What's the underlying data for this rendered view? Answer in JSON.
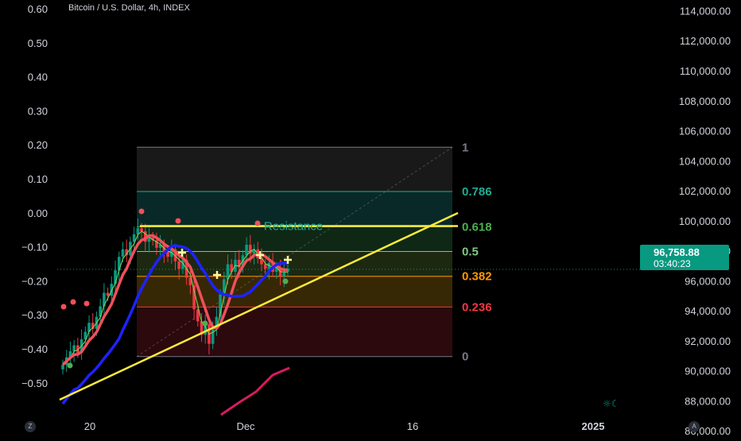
{
  "header": {
    "title": "Bitcoin / U.S. Dollar, 4h, INDEX"
  },
  "price_tag": {
    "price": "96,758.88",
    "countdown": "03:40:23"
  },
  "corner": {
    "left": "Z",
    "right": "A"
  },
  "colors": {
    "background": "#000000",
    "up": "#089981",
    "down": "#f23645",
    "ma_red": "#f0505a",
    "ma_blue": "#1e22ff",
    "ma_green": "#7ed957",
    "trendline": "#ffeb3b"
  },
  "chart_data": {
    "type": "candlestick",
    "left_axis": {
      "ticks": [
        0.6,
        0.5,
        0.4,
        0.3,
        0.2,
        0.1,
        0.0,
        -0.1,
        -0.2,
        -0.3,
        -0.4,
        -0.5
      ],
      "tick_labels": [
        "0.60",
        "0.50",
        "0.40",
        "0.30",
        "0.20",
        "0.10",
        "0.00",
        "−0.10",
        "−0.20",
        "−0.30",
        "−0.40",
        "−0.50"
      ]
    },
    "right_axis": {
      "ticks": [
        114000,
        112000,
        110000,
        108000,
        106000,
        104000,
        102000,
        100000,
        98000,
        96000,
        94000,
        92000,
        90000,
        88000,
        86000
      ],
      "tick_labels": [
        "114,000.00",
        "112,000.00",
        "110,000.00",
        "108,000.00",
        "106,000.00",
        "104,000.00",
        "102,000.00",
        "100,000.00",
        "98,000.00",
        "96,000.00",
        "94,000.00",
        "92,000.00",
        "90,000.00",
        "88,000.00",
        "86,000.00"
      ],
      "range": [
        85800,
        114500
      ]
    },
    "x_axis": {
      "tick_labels": [
        "20",
        "Dec",
        "16",
        "2025"
      ]
    },
    "last_price": 96758.88,
    "fib_levels": [
      {
        "level": 1,
        "label": "1",
        "price": 104900,
        "color": "#787b86"
      },
      {
        "level": 0.786,
        "label": "0.786",
        "price": 101950,
        "color": "#22ab94"
      },
      {
        "level": 0.618,
        "label": "0.618",
        "price": 99600,
        "color": "#4caf50"
      },
      {
        "level": 0.5,
        "label": "0.5",
        "price": 97950,
        "color": "#81c784"
      },
      {
        "level": 0.382,
        "label": "0.382",
        "price": 96300,
        "color": "#ff9800"
      },
      {
        "level": 0.236,
        "label": "0.236",
        "price": 94250,
        "color": "#f23645"
      },
      {
        "level": 0,
        "label": "0",
        "price": 90950,
        "color": "#787b86"
      }
    ],
    "annotations": [
      {
        "text": "Resistance",
        "price": 99650
      }
    ],
    "closes": [
      90400,
      90900,
      91300,
      91700,
      91200,
      92100,
      92600,
      93200,
      92800,
      93600,
      94300,
      95200,
      95000,
      95800,
      96700,
      97600,
      98100,
      97700,
      98600,
      99100,
      99500,
      99300,
      98600,
      98900,
      98700,
      98200,
      98400,
      97900,
      97600,
      98100,
      97300,
      96800,
      97400,
      96200,
      95700,
      94100,
      93300,
      92400,
      93100,
      91800,
      92800,
      93600,
      95100,
      96100,
      97100,
      96600,
      97400,
      96900,
      97700,
      98400,
      97800,
      98100,
      97500,
      97100,
      96800,
      97200,
      96600,
      96900,
      96300,
      96600,
      96800
    ]
  }
}
